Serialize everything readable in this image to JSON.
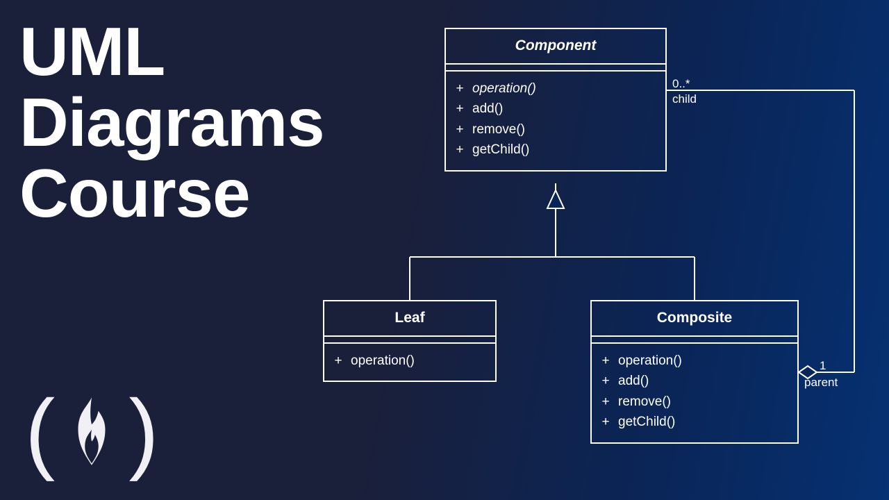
{
  "title": {
    "line1": "UML",
    "line2": "Diagrams",
    "line3": "Course"
  },
  "classes": {
    "component": {
      "name": "Component",
      "ops": [
        {
          "vis": "+",
          "sig": "operation()",
          "abstract": true
        },
        {
          "vis": "+",
          "sig": "add()"
        },
        {
          "vis": "+",
          "sig": "remove()"
        },
        {
          "vis": "+",
          "sig": "getChild()"
        }
      ],
      "abstract": true
    },
    "leaf": {
      "name": "Leaf",
      "ops": [
        {
          "vis": "+",
          "sig": "operation()"
        }
      ]
    },
    "composite": {
      "name": "Composite",
      "ops": [
        {
          "vis": "+",
          "sig": "operation()"
        },
        {
          "vis": "+",
          "sig": "add()"
        },
        {
          "vis": "+",
          "sig": "remove()"
        },
        {
          "vis": "+",
          "sig": "getChild()"
        }
      ]
    }
  },
  "associations": {
    "child": {
      "mult": "0..*",
      "role": "child"
    },
    "parent": {
      "mult": "1",
      "role": "parent"
    }
  }
}
